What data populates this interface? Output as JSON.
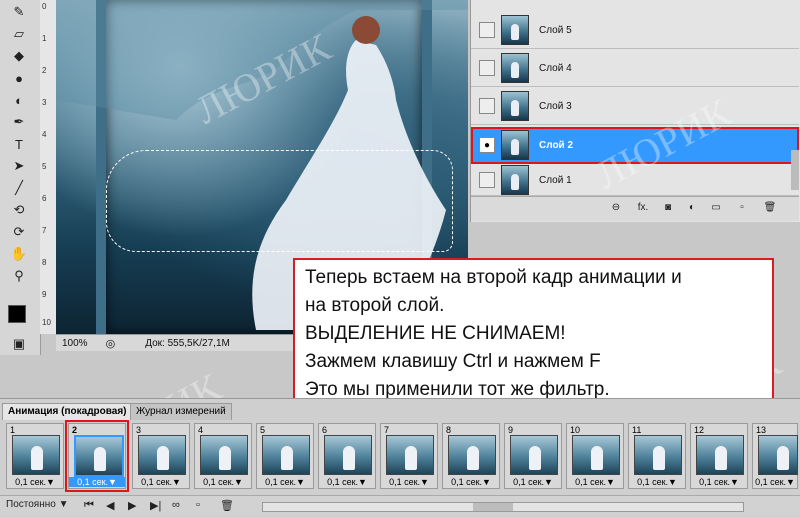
{
  "canvas": {
    "zoom": "100%",
    "doc_info": "Док: 555,5K/27,1M",
    "ruler_ticks": [
      "0",
      "1",
      "2",
      "3",
      "4",
      "5",
      "6",
      "7",
      "8",
      "9",
      "10"
    ]
  },
  "watermark": "ЛЮРИК",
  "layers": [
    {
      "name": "Слой 5",
      "visible": false,
      "active": false
    },
    {
      "name": "Слой 4",
      "visible": false,
      "active": false
    },
    {
      "name": "Слой 3",
      "visible": false,
      "active": false
    },
    {
      "name": "Слой 2",
      "visible": true,
      "active": true
    },
    {
      "name": "Слой 1",
      "visible": false,
      "active": false
    }
  ],
  "layers_footer_icons": [
    "link-icon",
    "fx-icon",
    "mask-icon",
    "adjustment-icon",
    "group-icon",
    "new-layer-icon",
    "trash-icon"
  ],
  "callout": {
    "lines": [
      "Теперь встаем на второй кадр анимации и",
      "на второй слой.",
      "ВЫДЕЛЕНИЕ НЕ СНИМАЕМ!",
      "Зажмем клавишу Ctrl  и  нажмем F",
      "Это мы применили тот же фильтр."
    ]
  },
  "animation": {
    "tabs": [
      "Анимация (покадровая)",
      "Журнал измерений"
    ],
    "frames": [
      {
        "num": "1",
        "delay": "0,1 сек.▼"
      },
      {
        "num": "2",
        "delay": "0,1 сек.▼"
      },
      {
        "num": "3",
        "delay": "0,1 сек.▼"
      },
      {
        "num": "4",
        "delay": "0,1 сек.▼"
      },
      {
        "num": "5",
        "delay": "0,1 сек.▼"
      },
      {
        "num": "6",
        "delay": "0,1 сек.▼"
      },
      {
        "num": "7",
        "delay": "0,1 сек.▼"
      },
      {
        "num": "8",
        "delay": "0,1 сек.▼"
      },
      {
        "num": "9",
        "delay": "0,1 сек.▼"
      },
      {
        "num": "10",
        "delay": "0,1 сек.▼"
      },
      {
        "num": "11",
        "delay": "0,1 сек.▼"
      },
      {
        "num": "12",
        "delay": "0,1 сек.▼"
      },
      {
        "num": "13",
        "delay": "0,1 сек.▼"
      }
    ],
    "active_frame": 1,
    "loop_label": "Постоянно ▼"
  },
  "colors": {
    "accent_red": "#e0141b",
    "selection_blue": "#3399ff"
  }
}
